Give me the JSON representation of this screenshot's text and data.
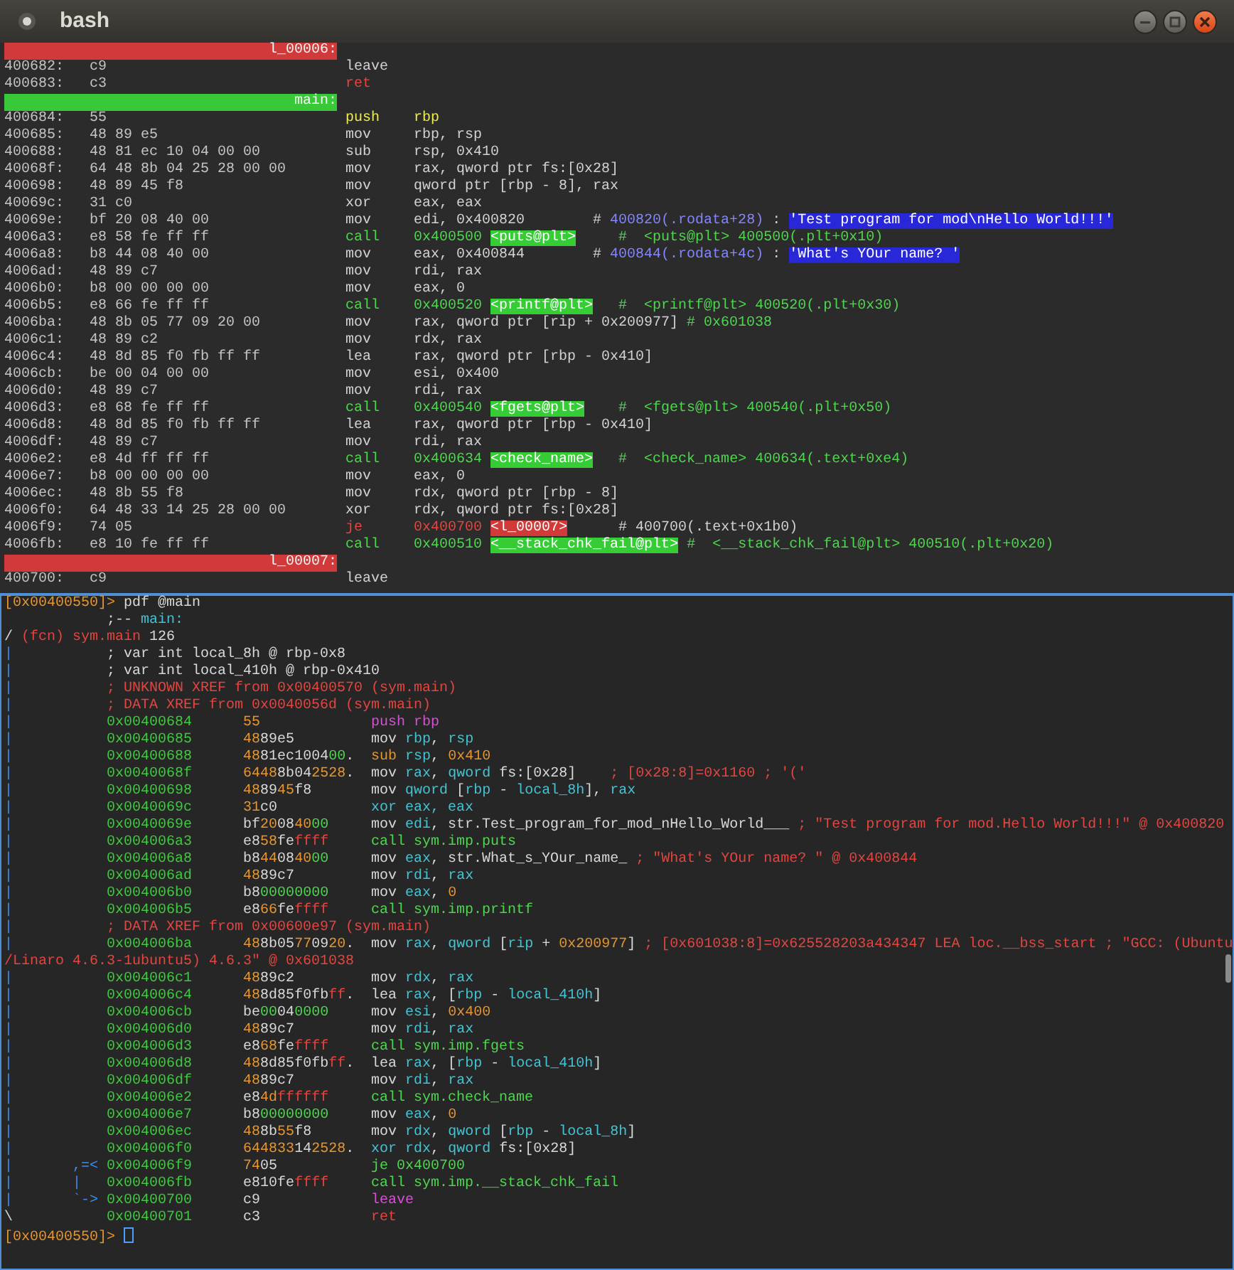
{
  "window": {
    "title": "bash"
  },
  "top_pane": {
    "lines": [
      {
        "kind": "label",
        "text": "l_00006:",
        "color": "#d03a3a"
      },
      {
        "kind": "insn",
        "addr": "400682:",
        "bytes": "c9",
        "op": {
          "text": "leave",
          "kind": "plain"
        }
      },
      {
        "kind": "insn",
        "addr": "400683:",
        "bytes": "c3",
        "op": {
          "text": "ret",
          "kind": "flow"
        }
      },
      {
        "kind": "label",
        "text": "main:",
        "color": "#38c838"
      },
      {
        "kind": "insn",
        "addr": "400684:",
        "bytes": "55",
        "op": {
          "text": "push",
          "kind": "stack"
        },
        "args": [
          {
            "text": "rbp",
            "kind": "stack"
          }
        ]
      },
      {
        "kind": "insn",
        "addr": "400685:",
        "bytes": "48 89 e5",
        "op": {
          "text": "mov",
          "kind": "plain"
        },
        "args": [
          {
            "text": "rbp, rsp",
            "kind": "plain"
          }
        ]
      },
      {
        "kind": "insn",
        "addr": "400688:",
        "bytes": "48 81 ec 10 04 00 00",
        "op": {
          "text": "sub",
          "kind": "plain"
        },
        "args": [
          {
            "text": "rsp, 0x410",
            "kind": "plain"
          }
        ]
      },
      {
        "kind": "insn",
        "addr": "40068f:",
        "bytes": "64 48 8b 04 25 28 00 00",
        "op": {
          "text": "mov",
          "kind": "plain"
        },
        "args": [
          {
            "text": "rax, qword ptr fs:[0x28]",
            "kind": "plain"
          }
        ]
      },
      {
        "kind": "insn",
        "addr": "400698:",
        "bytes": "48 89 45 f8",
        "op": {
          "text": "mov",
          "kind": "plain"
        },
        "args": [
          {
            "text": "qword ptr [rbp - 8], rax",
            "kind": "plain"
          }
        ]
      },
      {
        "kind": "insn",
        "addr": "40069c:",
        "bytes": "31 c0",
        "op": {
          "text": "xor",
          "kind": "plain"
        },
        "args": [
          {
            "text": "eax, eax",
            "kind": "plain"
          }
        ]
      },
      {
        "kind": "insn",
        "addr": "40069e:",
        "bytes": "bf 20 08 40 00",
        "op": {
          "text": "mov",
          "kind": "plain"
        },
        "args": [
          {
            "text": "edi, 0x400820        # ",
            "kind": "plain"
          },
          {
            "text": "400820(.rodata+28)",
            "kind": "ref"
          },
          {
            "text": " : ",
            "kind": "plain"
          },
          {
            "text": "'Test program for mod\\nHello World!!!'",
            "kind": "str"
          }
        ]
      },
      {
        "kind": "insn",
        "addr": "4006a3:",
        "bytes": "e8 58 fe ff ff",
        "op": {
          "text": "call",
          "kind": "call"
        },
        "args": [
          {
            "text": "0x400500 ",
            "kind": "call"
          },
          {
            "text": "<puts@plt>",
            "kind": "sym"
          },
          {
            "text": "     #  <puts@plt> 400500(.plt+0x10)",
            "kind": "call"
          }
        ]
      },
      {
        "kind": "insn",
        "addr": "4006a8:",
        "bytes": "b8 44 08 40 00",
        "op": {
          "text": "mov",
          "kind": "plain"
        },
        "args": [
          {
            "text": "eax, 0x400844        # ",
            "kind": "plain"
          },
          {
            "text": "400844(.rodata+4c)",
            "kind": "ref"
          },
          {
            "text": " : ",
            "kind": "plain"
          },
          {
            "text": "'What's YOur name? '",
            "kind": "str"
          }
        ]
      },
      {
        "kind": "insn",
        "addr": "4006ad:",
        "bytes": "48 89 c7",
        "op": {
          "text": "mov",
          "kind": "plain"
        },
        "args": [
          {
            "text": "rdi, rax",
            "kind": "plain"
          }
        ]
      },
      {
        "kind": "insn",
        "addr": "4006b0:",
        "bytes": "b8 00 00 00 00",
        "op": {
          "text": "mov",
          "kind": "plain"
        },
        "args": [
          {
            "text": "eax, 0",
            "kind": "plain"
          }
        ]
      },
      {
        "kind": "insn",
        "addr": "4006b5:",
        "bytes": "e8 66 fe ff ff",
        "op": {
          "text": "call",
          "kind": "call"
        },
        "args": [
          {
            "text": "0x400520 ",
            "kind": "call"
          },
          {
            "text": "<printf@plt>",
            "kind": "sym"
          },
          {
            "text": "   #  <printf@plt> 400520(.plt+0x30)",
            "kind": "call"
          }
        ]
      },
      {
        "kind": "insn",
        "addr": "4006ba:",
        "bytes": "48 8b 05 77 09 20 00",
        "op": {
          "text": "mov",
          "kind": "plain"
        },
        "args": [
          {
            "text": "rax, qword ptr [rip + 0x200977] ",
            "kind": "plain"
          },
          {
            "text": "# 0x601038",
            "kind": "call"
          }
        ]
      },
      {
        "kind": "insn",
        "addr": "4006c1:",
        "bytes": "48 89 c2",
        "op": {
          "text": "mov",
          "kind": "plain"
        },
        "args": [
          {
            "text": "rdx, rax",
            "kind": "plain"
          }
        ]
      },
      {
        "kind": "insn",
        "addr": "4006c4:",
        "bytes": "48 8d 85 f0 fb ff ff",
        "op": {
          "text": "lea",
          "kind": "plain"
        },
        "args": [
          {
            "text": "rax, qword ptr [rbp - 0x410]",
            "kind": "plain"
          }
        ]
      },
      {
        "kind": "insn",
        "addr": "4006cb:",
        "bytes": "be 00 04 00 00",
        "op": {
          "text": "mov",
          "kind": "plain"
        },
        "args": [
          {
            "text": "esi, 0x400",
            "kind": "plain"
          }
        ]
      },
      {
        "kind": "insn",
        "addr": "4006d0:",
        "bytes": "48 89 c7",
        "op": {
          "text": "mov",
          "kind": "plain"
        },
        "args": [
          {
            "text": "rdi, rax",
            "kind": "plain"
          }
        ]
      },
      {
        "kind": "insn",
        "addr": "4006d3:",
        "bytes": "e8 68 fe ff ff",
        "op": {
          "text": "call",
          "kind": "call"
        },
        "args": [
          {
            "text": "0x400540 ",
            "kind": "call"
          },
          {
            "text": "<fgets@plt>",
            "kind": "sym"
          },
          {
            "text": "    #  <fgets@plt> 400540(.plt+0x50)",
            "kind": "call"
          }
        ]
      },
      {
        "kind": "insn",
        "addr": "4006d8:",
        "bytes": "48 8d 85 f0 fb ff ff",
        "op": {
          "text": "lea",
          "kind": "plain"
        },
        "args": [
          {
            "text": "rax, qword ptr [rbp - 0x410]",
            "kind": "plain"
          }
        ]
      },
      {
        "kind": "insn",
        "addr": "4006df:",
        "bytes": "48 89 c7",
        "op": {
          "text": "mov",
          "kind": "plain"
        },
        "args": [
          {
            "text": "rdi, rax",
            "kind": "plain"
          }
        ]
      },
      {
        "kind": "insn",
        "addr": "4006e2:",
        "bytes": "e8 4d ff ff ff",
        "op": {
          "text": "call",
          "kind": "call"
        },
        "args": [
          {
            "text": "0x400634 ",
            "kind": "call"
          },
          {
            "text": "<check_name>",
            "kind": "sym"
          },
          {
            "text": "   #  <check_name> 400634(.text+0xe4)",
            "kind": "call"
          }
        ]
      },
      {
        "kind": "insn",
        "addr": "4006e7:",
        "bytes": "b8 00 00 00 00",
        "op": {
          "text": "mov",
          "kind": "plain"
        },
        "args": [
          {
            "text": "eax, 0",
            "kind": "plain"
          }
        ]
      },
      {
        "kind": "insn",
        "addr": "4006ec:",
        "bytes": "48 8b 55 f8",
        "op": {
          "text": "mov",
          "kind": "plain"
        },
        "args": [
          {
            "text": "rdx, qword ptr [rbp - 8]",
            "kind": "plain"
          }
        ]
      },
      {
        "kind": "insn",
        "addr": "4006f0:",
        "bytes": "64 48 33 14 25 28 00 00",
        "op": {
          "text": "xor",
          "kind": "plain"
        },
        "args": [
          {
            "text": "rdx, qword ptr fs:[0x28]",
            "kind": "plain"
          }
        ]
      },
      {
        "kind": "insn",
        "addr": "4006f9:",
        "bytes": "74 05",
        "op": {
          "text": "je",
          "kind": "flow"
        },
        "args": [
          {
            "text": "0x400700 ",
            "kind": "flow"
          },
          {
            "text": "<l_00007>",
            "kind": "lbl"
          },
          {
            "text": "      # 400700(.text+0x1b0)",
            "kind": "plain"
          }
        ]
      },
      {
        "kind": "insn",
        "addr": "4006fb:",
        "bytes": "e8 10 fe ff ff",
        "op": {
          "text": "call",
          "kind": "call"
        },
        "args": [
          {
            "text": "0x400510 ",
            "kind": "call"
          },
          {
            "text": "<__stack_chk_fail@plt>",
            "kind": "sym"
          },
          {
            "text": " #  <__stack_chk_fail@plt> 400510(.plt+0x20)",
            "kind": "call"
          }
        ]
      },
      {
        "kind": "label",
        "text": "l_00007:",
        "color": "#d03a3a"
      },
      {
        "kind": "insn",
        "addr": "400700:",
        "bytes": "c9",
        "op": {
          "text": "leave",
          "kind": "plain"
        }
      }
    ]
  },
  "bottom_pane": {
    "lines": [
      {
        "kind": "prompt",
        "spans": [
          {
            "text": "[0x00400550]>",
            "kind": "prompt"
          },
          {
            "text": " pdf @main",
            "kind": "plain"
          }
        ]
      },
      {
        "kind": "comment",
        "spans": [
          {
            "text": ";-- ",
            "kind": "plain"
          },
          {
            "text": "main:",
            "kind": "flag"
          }
        ]
      },
      {
        "kind": "text",
        "spans": [
          {
            "text": "/ ",
            "kind": "plain"
          },
          {
            "text": "(fcn) sym.main",
            "kind": "warn"
          },
          {
            "text": " 126",
            "kind": "plain"
          }
        ]
      },
      {
        "kind": "comment",
        "gutter": "|",
        "spans": [
          {
            "text": "; var int local_8h @ rbp-0x8",
            "kind": "plain"
          }
        ]
      },
      {
        "kind": "comment",
        "gutter": "|",
        "spans": [
          {
            "text": "; var int local_410h @ rbp-0x410",
            "kind": "plain"
          }
        ]
      },
      {
        "kind": "comment",
        "gutter": "|",
        "spans": [
          {
            "text": "; UNKNOWN XREF from 0x00400570 (sym.main)",
            "kind": "warn"
          }
        ]
      },
      {
        "kind": "comment",
        "gutter": "|",
        "spans": [
          {
            "text": "; DATA XREF from 0x0040056d (sym.main)",
            "kind": "warn"
          }
        ]
      },
      {
        "kind": "insn",
        "gutter": "|",
        "addr": "0x00400684",
        "bytes": "55",
        "asm": [
          {
            "text": "push rbp",
            "kind": "stack"
          }
        ]
      },
      {
        "kind": "insn",
        "gutter": "|",
        "addr": "0x00400685",
        "bytes": "4889e5",
        "asm": [
          {
            "text": "mov ",
            "kind": "plain"
          },
          {
            "text": "rbp",
            "kind": "reg"
          },
          {
            "text": ", ",
            "kind": "plain"
          },
          {
            "text": "rsp",
            "kind": "reg"
          }
        ]
      },
      {
        "kind": "insn",
        "gutter": "|",
        "addr": "0x00400688",
        "bytes": "4881ec100400.",
        "asm": [
          {
            "text": "sub ",
            "kind": "num"
          },
          {
            "text": "rsp",
            "kind": "reg"
          },
          {
            "text": ", ",
            "kind": "plain"
          },
          {
            "text": "0x410",
            "kind": "num"
          }
        ]
      },
      {
        "kind": "insn",
        "gutter": "|",
        "addr": "0x0040068f",
        "bytes": "64488b042528.",
        "asm": [
          {
            "text": "mov ",
            "kind": "plain"
          },
          {
            "text": "rax",
            "kind": "reg"
          },
          {
            "text": ", ",
            "kind": "plain"
          },
          {
            "text": "qword",
            "kind": "reg"
          },
          {
            "text": " fs:[0x28]",
            "kind": "plain"
          },
          {
            "text": "    ; [0x28:8]=0x1160 ; '('",
            "kind": "warn"
          }
        ]
      },
      {
        "kind": "insn",
        "gutter": "|",
        "addr": "0x00400698",
        "bytes": "488945f8",
        "asm": [
          {
            "text": "mov ",
            "kind": "plain"
          },
          {
            "text": "qword",
            "kind": "reg"
          },
          {
            "text": " [",
            "kind": "plain"
          },
          {
            "text": "rbp",
            "kind": "reg"
          },
          {
            "text": " - ",
            "kind": "plain"
          },
          {
            "text": "local_8h",
            "kind": "reg"
          },
          {
            "text": "], ",
            "kind": "plain"
          },
          {
            "text": "rax",
            "kind": "reg"
          }
        ]
      },
      {
        "kind": "insn",
        "gutter": "|",
        "addr": "0x0040069c",
        "bytes": "31c0",
        "asm": [
          {
            "text": "xor eax, eax",
            "kind": "reg"
          }
        ]
      },
      {
        "kind": "insn",
        "gutter": "|",
        "addr": "0x0040069e",
        "bytes": "bf20084000",
        "asm": [
          {
            "text": "mov ",
            "kind": "plain"
          },
          {
            "text": "edi",
            "kind": "reg"
          },
          {
            "text": ", str.Test_program_for_mod_nHello_World___",
            "kind": "plain"
          },
          {
            "text": " ; \"Test program for mod.Hello World!!!\" @ 0x400820",
            "kind": "warn"
          }
        ]
      },
      {
        "kind": "insn",
        "gutter": "|",
        "addr": "0x004006a3",
        "bytes": "e858feffff",
        "asm": [
          {
            "text": "call sym.imp.puts",
            "kind": "call"
          }
        ]
      },
      {
        "kind": "insn",
        "gutter": "|",
        "addr": "0x004006a8",
        "bytes": "b844084000",
        "asm": [
          {
            "text": "mov ",
            "kind": "plain"
          },
          {
            "text": "eax",
            "kind": "reg"
          },
          {
            "text": ", str.What_s_YOur_name_",
            "kind": "plain"
          },
          {
            "text": " ; \"What's YOur name? \" @ 0x400844",
            "kind": "warn"
          }
        ]
      },
      {
        "kind": "insn",
        "gutter": "|",
        "addr": "0x004006ad",
        "bytes": "4889c7",
        "asm": [
          {
            "text": "mov ",
            "kind": "plain"
          },
          {
            "text": "rdi",
            "kind": "reg"
          },
          {
            "text": ", ",
            "kind": "plain"
          },
          {
            "text": "rax",
            "kind": "reg"
          }
        ]
      },
      {
        "kind": "insn",
        "gutter": "|",
        "addr": "0x004006b0",
        "bytes": "b800000000",
        "asm": [
          {
            "text": "mov ",
            "kind": "plain"
          },
          {
            "text": "eax",
            "kind": "reg"
          },
          {
            "text": ", ",
            "kind": "plain"
          },
          {
            "text": "0",
            "kind": "num"
          }
        ]
      },
      {
        "kind": "insn",
        "gutter": "|",
        "addr": "0x004006b5",
        "bytes": "e866feffff",
        "asm": [
          {
            "text": "call sym.imp.printf",
            "kind": "call"
          }
        ]
      },
      {
        "kind": "comment",
        "gutter": "|",
        "spans": [
          {
            "text": "; DATA XREF from 0x00600e97 (sym.main)",
            "kind": "warn"
          }
        ]
      },
      {
        "kind": "insn",
        "gutter": "|",
        "addr": "0x004006ba",
        "bytes": "488b05770920.",
        "asm": [
          {
            "text": "mov ",
            "kind": "plain"
          },
          {
            "text": "rax",
            "kind": "reg"
          },
          {
            "text": ", ",
            "kind": "plain"
          },
          {
            "text": "qword",
            "kind": "reg"
          },
          {
            "text": " [",
            "kind": "plain"
          },
          {
            "text": "rip",
            "kind": "reg"
          },
          {
            "text": " + ",
            "kind": "plain"
          },
          {
            "text": "0x200977",
            "kind": "num"
          },
          {
            "text": "]",
            "kind": "plain"
          },
          {
            "text": " ; [0x601038:8]=0x625528203a434347 LEA loc.__bss_start ; \"GCC: (Ubuntu",
            "kind": "warn"
          }
        ]
      },
      {
        "kind": "text",
        "spans": [
          {
            "text": "/Linaro 4.6.3-1ubuntu5) 4.6.3\" @ 0x601038",
            "kind": "warn"
          }
        ]
      },
      {
        "kind": "insn",
        "gutter": "|",
        "addr": "0x004006c1",
        "bytes": "4889c2",
        "asm": [
          {
            "text": "mov ",
            "kind": "plain"
          },
          {
            "text": "rdx",
            "kind": "reg"
          },
          {
            "text": ", ",
            "kind": "plain"
          },
          {
            "text": "rax",
            "kind": "reg"
          }
        ]
      },
      {
        "kind": "insn",
        "gutter": "|",
        "addr": "0x004006c4",
        "bytes": "488d85f0fbff.",
        "asm": [
          {
            "text": "lea ",
            "kind": "plain"
          },
          {
            "text": "rax",
            "kind": "reg"
          },
          {
            "text": ", [",
            "kind": "plain"
          },
          {
            "text": "rbp",
            "kind": "reg"
          },
          {
            "text": " - ",
            "kind": "plain"
          },
          {
            "text": "local_410h",
            "kind": "reg"
          },
          {
            "text": "]",
            "kind": "plain"
          }
        ]
      },
      {
        "kind": "insn",
        "gutter": "|",
        "addr": "0x004006cb",
        "bytes": "be00040000",
        "asm": [
          {
            "text": "mov ",
            "kind": "plain"
          },
          {
            "text": "esi",
            "kind": "reg"
          },
          {
            "text": ", ",
            "kind": "plain"
          },
          {
            "text": "0x400",
            "kind": "num"
          }
        ]
      },
      {
        "kind": "insn",
        "gutter": "|",
        "addr": "0x004006d0",
        "bytes": "4889c7",
        "asm": [
          {
            "text": "mov ",
            "kind": "plain"
          },
          {
            "text": "rdi",
            "kind": "reg"
          },
          {
            "text": ", ",
            "kind": "plain"
          },
          {
            "text": "rax",
            "kind": "reg"
          }
        ]
      },
      {
        "kind": "insn",
        "gutter": "|",
        "addr": "0x004006d3",
        "bytes": "e868feffff",
        "asm": [
          {
            "text": "call sym.imp.fgets",
            "kind": "call"
          }
        ]
      },
      {
        "kind": "insn",
        "gutter": "|",
        "addr": "0x004006d8",
        "bytes": "488d85f0fbff.",
        "asm": [
          {
            "text": "lea ",
            "kind": "plain"
          },
          {
            "text": "rax",
            "kind": "reg"
          },
          {
            "text": ", [",
            "kind": "plain"
          },
          {
            "text": "rbp",
            "kind": "reg"
          },
          {
            "text": " - ",
            "kind": "plain"
          },
          {
            "text": "local_410h",
            "kind": "reg"
          },
          {
            "text": "]",
            "kind": "plain"
          }
        ]
      },
      {
        "kind": "insn",
        "gutter": "|",
        "addr": "0x004006df",
        "bytes": "4889c7",
        "asm": [
          {
            "text": "mov ",
            "kind": "plain"
          },
          {
            "text": "rdi",
            "kind": "reg"
          },
          {
            "text": ", ",
            "kind": "plain"
          },
          {
            "text": "rax",
            "kind": "reg"
          }
        ]
      },
      {
        "kind": "insn",
        "gutter": "|",
        "addr": "0x004006e2",
        "bytes": "e84dffffff",
        "asm": [
          {
            "text": "call sym.check_name",
            "kind": "call"
          }
        ]
      },
      {
        "kind": "insn",
        "gutter": "|",
        "addr": "0x004006e7",
        "bytes": "b800000000",
        "asm": [
          {
            "text": "mov ",
            "kind": "plain"
          },
          {
            "text": "eax",
            "kind": "reg"
          },
          {
            "text": ", ",
            "kind": "plain"
          },
          {
            "text": "0",
            "kind": "num"
          }
        ]
      },
      {
        "kind": "insn",
        "gutter": "|",
        "addr": "0x004006ec",
        "bytes": "488b55f8",
        "asm": [
          {
            "text": "mov ",
            "kind": "plain"
          },
          {
            "text": "rdx",
            "kind": "reg"
          },
          {
            "text": ", ",
            "kind": "plain"
          },
          {
            "text": "qword",
            "kind": "reg"
          },
          {
            "text": " [",
            "kind": "plain"
          },
          {
            "text": "rbp",
            "kind": "reg"
          },
          {
            "text": " - ",
            "kind": "plain"
          },
          {
            "text": "local_8h",
            "kind": "reg"
          },
          {
            "text": "]",
            "kind": "plain"
          }
        ]
      },
      {
        "kind": "insn",
        "gutter": "|",
        "addr": "0x004006f0",
        "bytes": "644833142528.",
        "asm": [
          {
            "text": "xor ",
            "kind": "reg"
          },
          {
            "text": "rdx",
            "kind": "reg"
          },
          {
            "text": ", ",
            "kind": "plain"
          },
          {
            "text": "qword",
            "kind": "reg"
          },
          {
            "text": " fs:[0x28]",
            "kind": "plain"
          }
        ]
      },
      {
        "kind": "insn",
        "gutter": "|       ,=<",
        "addr": "0x004006f9",
        "bytes": "7405",
        "asm": [
          {
            "text": "je 0x400700",
            "kind": "jump"
          }
        ]
      },
      {
        "kind": "insn",
        "gutter": "|       |",
        "addr": "0x004006fb",
        "bytes": "e810feffff",
        "asm": [
          {
            "text": "call sym.imp.__stack_chk_fail",
            "kind": "call"
          }
        ]
      },
      {
        "kind": "insn",
        "gutter": "|       `->",
        "addr": "0x00400700",
        "bytes": "c9",
        "asm": [
          {
            "text": "leave",
            "kind": "stack"
          }
        ]
      },
      {
        "kind": "insn",
        "gutter": "\\",
        "addr": "0x00400701",
        "bytes": "c3",
        "asm": [
          {
            "text": "ret",
            "kind": "flow"
          }
        ]
      },
      {
        "kind": "prompt",
        "spans": [
          {
            "text": "[0x00400550]>",
            "kind": "prompt"
          }
        ],
        "cursor": true
      }
    ]
  }
}
